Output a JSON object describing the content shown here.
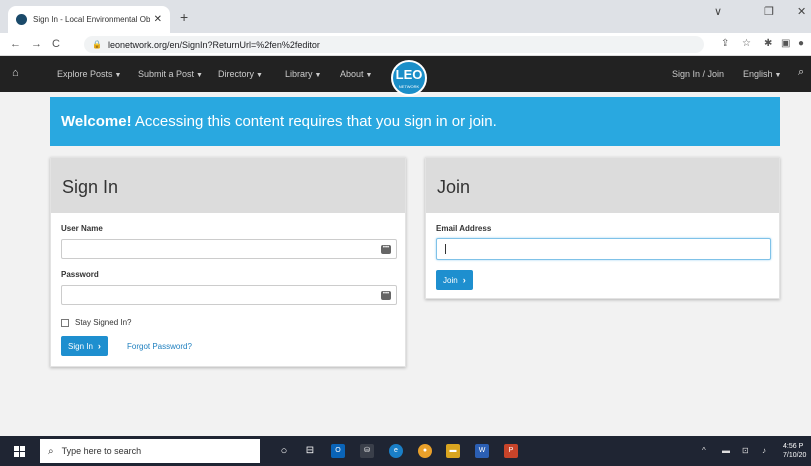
{
  "browser": {
    "tab_title": "Sign In - Local Environmental Ob",
    "tab_close": "✕",
    "new_tab": "+",
    "url": "leonetwork.org/en/SignIn?ReturnUrl=%2fen%2feditor",
    "controls": {
      "minimize": "∨",
      "restore": "❐",
      "close": "✕"
    }
  },
  "navbar": {
    "home_icon": "home-icon",
    "items": [
      {
        "label": "Explore Posts"
      },
      {
        "label": "Submit a Post"
      },
      {
        "label": "Directory"
      },
      {
        "label": "Library"
      },
      {
        "label": "About"
      }
    ],
    "logo_text": "LEO",
    "logo_sub": "NETWORK",
    "signin_join": "Sign In / Join",
    "language": "English"
  },
  "banner": {
    "bold": "Welcome!",
    "message": " Accessing this content requires that you sign in or join."
  },
  "signin": {
    "title": "Sign In",
    "username_label": "User Name",
    "username_value": "",
    "password_label": "Password",
    "password_value": "",
    "stay_signed_in": "Stay Signed In?",
    "button": "Sign In",
    "forgot": "Forgot Password?"
  },
  "join": {
    "title": "Join",
    "email_label": "Email Address",
    "email_value": "",
    "button": "Join"
  },
  "taskbar": {
    "search_placeholder": "Type here to search",
    "time": "4:56 P",
    "date": "7/10/20"
  },
  "colors": {
    "accent": "#29a8e0",
    "button": "#1e8fcf",
    "navbar": "#222222"
  }
}
